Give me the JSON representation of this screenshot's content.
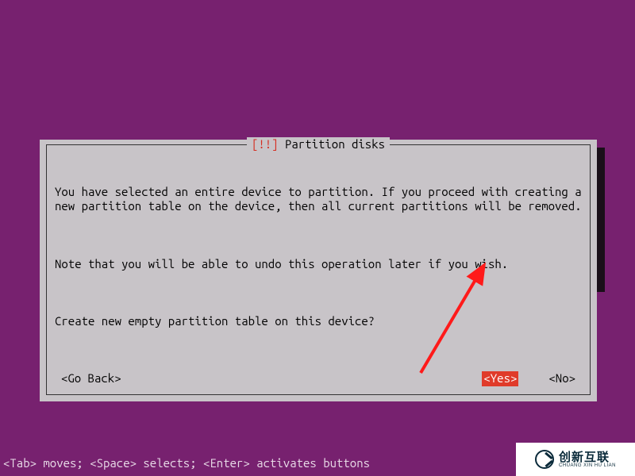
{
  "dialog": {
    "title_prefix": "[!!]",
    "title": "Partition disks",
    "paragraph1": "You have selected an entire device to partition. If you proceed with creating a new partition table on the device, then all current partitions will be removed.",
    "paragraph2": "Note that you will be able to undo this operation later if you wish.",
    "question": "Create new empty partition table on this device?",
    "go_back": "<Go Back>",
    "yes": "<Yes>",
    "no": "<No>"
  },
  "footer": "<Tab> moves; <Space> selects; <Enter> activates buttons",
  "logo": {
    "cn": "创新互联",
    "en": "CHUANG XIN HU LIAN"
  },
  "colors": {
    "background": "#77216F",
    "dialog_bg": "#c8c4c8",
    "highlight": "#e03b2a",
    "accent_red": "#d62b1f"
  }
}
